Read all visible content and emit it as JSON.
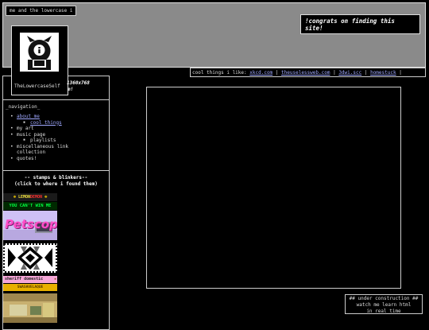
{
  "site": {
    "title": "me and the lowercase i"
  },
  "banner": {
    "congrats": "!congrats on finding this site!"
  },
  "profile": {
    "name": "TheLowercaseSelf",
    "resolution_note_line1": "1360x768",
    "resolution_note_line2": "m!"
  },
  "cool_things": {
    "label": "cool things i like:",
    "links": [
      "xkcd.com",
      "theuselessweb.com",
      "3dwi.scc",
      "homestuck"
    ],
    "separator": " | "
  },
  "navigation": {
    "title": "_navigation_",
    "items": [
      {
        "label": "about me",
        "link": true,
        "level": 0
      },
      {
        "label": "cool things",
        "link": true,
        "level": 1
      },
      {
        "label": "my art",
        "link": false,
        "level": 0
      },
      {
        "label": "music page",
        "link": false,
        "level": 0
      },
      {
        "label": "playlists",
        "link": false,
        "level": 1
      },
      {
        "label": "miscellaneous link",
        "link": false,
        "level": 0
      },
      {
        "label": "collection",
        "link": false,
        "level": 0,
        "continuation": true
      },
      {
        "label": "quotes!",
        "link": false,
        "level": 0
      }
    ]
  },
  "stamps": {
    "title_line1": "-- stamps & blinkers--",
    "title_line2": "(click to where i found them)",
    "badges": [
      {
        "text_left": "LEMON",
        "text_right": "DEMON",
        "name": "lemon-demon-badge"
      },
      {
        "text": "YOU CAN'T WIN ME",
        "name": "you-cant-win-me-badge"
      },
      {
        "text": "Petscop",
        "name": "petscop-stamp"
      },
      {
        "name": "geometric-pattern-stamp"
      },
      {
        "text": "sheriff domestic",
        "name": "sheriff-domestic-badge"
      },
      {
        "text": "SWASHVELAQUE",
        "name": "yellow-badge"
      },
      {
        "name": "room-scene-stamp"
      }
    ]
  },
  "under_construction": {
    "line1": "## under construction ##",
    "line2": "watch me learn html",
    "line3": "in real time"
  },
  "colors": {
    "link": "#9fa8ff",
    "banner": "#8a8a8a",
    "background": "#000000"
  }
}
